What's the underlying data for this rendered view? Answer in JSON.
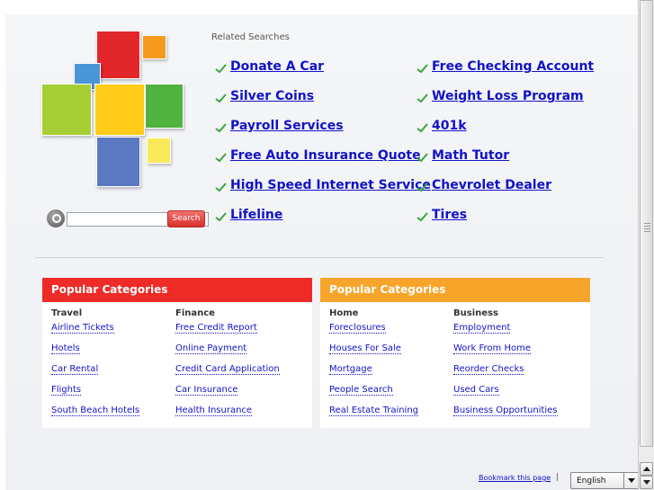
{
  "search": {
    "placeholder": "",
    "button_label": "Search"
  },
  "related": {
    "title": "Related Searches",
    "left": [
      "Donate A Car",
      "Silver Coins",
      "Payroll Services",
      "Free Auto Insurance Quote",
      "High Speed Internet Service",
      "Lifeline"
    ],
    "right": [
      "Free Checking Account",
      "Weight Loss Program",
      "401k",
      "Math Tutor",
      "Chevrolet Dealer",
      "Tires"
    ]
  },
  "categories": [
    {
      "title": "Popular Categories",
      "color": "#ee2b27",
      "columns": [
        {
          "heading": "Travel",
          "links": [
            "Airline Tickets",
            "Hotels",
            "Car Rental",
            "Flights",
            "South Beach Hotels"
          ]
        },
        {
          "heading": "Finance",
          "links": [
            "Free Credit Report",
            "Online Payment",
            "Credit Card Application",
            "Car Insurance",
            "Health Insurance"
          ]
        }
      ]
    },
    {
      "title": "Popular Categories",
      "color": "#f7a52a",
      "columns": [
        {
          "heading": "Home",
          "links": [
            "Foreclosures",
            "Houses For Sale",
            "Mortgage",
            "People Search",
            "Real Estate Training"
          ]
        },
        {
          "heading": "Business",
          "links": [
            "Employment",
            "Work From Home",
            "Reorder Checks",
            "Used Cars",
            "Business Opportunities"
          ]
        }
      ]
    }
  ],
  "footer": {
    "bookmark": "Bookmark this page",
    "separator": "|",
    "language": "English"
  },
  "colors": {
    "link": "#1212c8",
    "check": "#3aa53a",
    "red": "#ee2b27",
    "orange": "#f7a52a"
  }
}
